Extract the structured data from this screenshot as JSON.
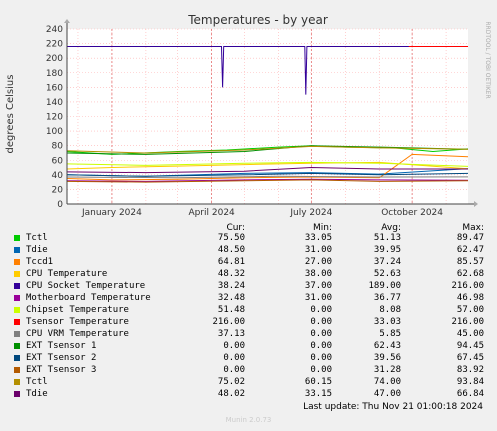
{
  "chart_data": {
    "type": "line",
    "title": "Temperatures - by year",
    "ylabel": "degrees Celsius",
    "side_label": "RRDTOOL / TOBI OETIKER",
    "ylim": [
      0,
      240
    ],
    "yticks": [
      0,
      20,
      40,
      60,
      80,
      100,
      120,
      140,
      160,
      180,
      200,
      220,
      240
    ],
    "xlim": [
      "2023-11-21",
      "2024-11-21"
    ],
    "xticks": [
      {
        "label": "January 2024",
        "date": "2024-01-01"
      },
      {
        "label": "April 2024",
        "date": "2024-04-01"
      },
      {
        "label": "July 2024",
        "date": "2024-07-01"
      },
      {
        "label": "October 2024",
        "date": "2024-10-01"
      }
    ],
    "grid": true,
    "series": [
      {
        "name": "Tctl",
        "color": "#00cc00",
        "points": [
          [
            "2023-11-21",
            72
          ],
          [
            "2024-01-01",
            68
          ],
          [
            "2024-03-01",
            72
          ],
          [
            "2024-04-15",
            74
          ],
          [
            "2024-06-01",
            78
          ],
          [
            "2024-07-01",
            80
          ],
          [
            "2024-08-01",
            78
          ],
          [
            "2024-09-15",
            77
          ],
          [
            "2024-10-20",
            72
          ],
          [
            "2024-11-21",
            75.5
          ]
        ]
      },
      {
        "name": "Tdie",
        "color": "#0066b3",
        "points": [
          [
            "2023-11-21",
            40
          ],
          [
            "2024-02-01",
            38
          ],
          [
            "2024-05-01",
            42
          ],
          [
            "2024-07-01",
            43
          ],
          [
            "2024-09-01",
            41
          ],
          [
            "2024-11-21",
            48.5
          ]
        ]
      },
      {
        "name": "Tccd1",
        "color": "#ff8000",
        "points": [
          [
            "2023-11-21",
            35
          ],
          [
            "2024-01-01",
            33
          ],
          [
            "2024-03-01",
            34
          ],
          [
            "2024-05-01",
            36
          ],
          [
            "2024-07-01",
            37
          ],
          [
            "2024-09-01",
            36
          ],
          [
            "2024-10-01",
            68
          ],
          [
            "2024-11-21",
            64.8
          ]
        ]
      },
      {
        "name": "CPU Temperature",
        "color": "#ffcc00",
        "points": [
          [
            "2023-11-21",
            48
          ],
          [
            "2024-01-01",
            50
          ],
          [
            "2024-03-01",
            52
          ],
          [
            "2024-05-01",
            54
          ],
          [
            "2024-07-01",
            56
          ],
          [
            "2024-09-01",
            57
          ],
          [
            "2024-11-21",
            48.3
          ]
        ]
      },
      {
        "name": "CPU Socket Temperature",
        "color": "#330099",
        "points": [
          [
            "2023-11-21",
            216
          ],
          [
            "2024-04-10",
            216
          ],
          [
            "2024-04-11",
            160
          ],
          [
            "2024-04-12",
            216
          ],
          [
            "2024-06-25",
            216
          ],
          [
            "2024-06-26",
            150
          ],
          [
            "2024-06-27",
            216
          ],
          [
            "2024-11-21",
            216
          ]
        ]
      },
      {
        "name": "Motherboard Temperature",
        "color": "#990099",
        "points": [
          [
            "2023-11-21",
            32
          ],
          [
            "2024-02-01",
            31
          ],
          [
            "2024-05-01",
            33
          ],
          [
            "2024-07-01",
            34
          ],
          [
            "2024-09-01",
            33
          ],
          [
            "2024-11-21",
            32.5
          ]
        ]
      },
      {
        "name": "Chipset Temperature",
        "color": "#ccff00",
        "points": [
          [
            "2023-11-21",
            55
          ],
          [
            "2024-02-01",
            53
          ],
          [
            "2024-05-01",
            56
          ],
          [
            "2024-07-01",
            57
          ],
          [
            "2024-09-01",
            56
          ],
          [
            "2024-11-21",
            51.5
          ]
        ]
      },
      {
        "name": "Tsensor Temperature",
        "color": "#ff0000",
        "points": [
          [
            "2024-09-28",
            216
          ],
          [
            "2024-11-21",
            216
          ]
        ]
      },
      {
        "name": "CPU VRM Temperature",
        "color": "#808080",
        "points": [
          [
            "2023-11-21",
            37
          ],
          [
            "2024-03-01",
            36
          ],
          [
            "2024-06-01",
            38
          ],
          [
            "2024-09-01",
            37
          ],
          [
            "2024-11-21",
            37.1
          ]
        ]
      },
      {
        "name": "EXT Tsensor 1",
        "color": "#008f00",
        "points": [
          [
            "2023-11-21",
            70
          ],
          [
            "2024-02-01",
            68
          ],
          [
            "2024-05-01",
            72
          ],
          [
            "2024-07-01",
            80
          ],
          [
            "2024-09-01",
            78
          ],
          [
            "2024-11-21",
            75
          ]
        ]
      },
      {
        "name": "EXT Tsensor 2",
        "color": "#00487d",
        "points": [
          [
            "2023-11-21",
            40
          ],
          [
            "2024-02-01",
            38
          ],
          [
            "2024-05-01",
            40
          ],
          [
            "2024-07-01",
            42
          ],
          [
            "2024-09-01",
            40
          ],
          [
            "2024-11-21",
            42
          ]
        ]
      },
      {
        "name": "EXT Tsensor 3",
        "color": "#b35a00",
        "points": [
          [
            "2023-11-21",
            31
          ],
          [
            "2024-02-01",
            30
          ],
          [
            "2024-05-01",
            32
          ],
          [
            "2024-07-01",
            33
          ],
          [
            "2024-09-01",
            31
          ],
          [
            "2024-11-21",
            32
          ]
        ]
      },
      {
        "name": "Tctl",
        "color": "#b38f00",
        "points": [
          [
            "2023-11-21",
            73
          ],
          [
            "2024-02-01",
            70
          ],
          [
            "2024-05-01",
            74
          ],
          [
            "2024-07-01",
            79
          ],
          [
            "2024-09-01",
            77
          ],
          [
            "2024-11-21",
            75
          ]
        ]
      },
      {
        "name": "Tdie",
        "color": "#6b006b",
        "points": [
          [
            "2023-11-21",
            44
          ],
          [
            "2024-02-01",
            43
          ],
          [
            "2024-05-01",
            45
          ],
          [
            "2024-07-01",
            50
          ],
          [
            "2024-09-01",
            48
          ],
          [
            "2024-11-21",
            48
          ]
        ]
      }
    ]
  },
  "legend": {
    "headers": {
      "cur": "Cur:",
      "min": "Min:",
      "avg": "Avg:",
      "max": "Max:"
    },
    "rows": [
      {
        "name": "Tctl",
        "color": "#00cc00",
        "cur": "75.50",
        "min": "33.05",
        "avg": "51.13",
        "max": "89.47"
      },
      {
        "name": "Tdie",
        "color": "#0066b3",
        "cur": "48.50",
        "min": "31.00",
        "avg": "39.95",
        "max": "62.47"
      },
      {
        "name": "Tccd1",
        "color": "#ff8000",
        "cur": "64.81",
        "min": "27.00",
        "avg": "37.24",
        "max": "85.57"
      },
      {
        "name": "CPU Temperature",
        "color": "#ffcc00",
        "cur": "48.32",
        "min": "38.00",
        "avg": "52.63",
        "max": "62.68"
      },
      {
        "name": "CPU Socket Temperature",
        "color": "#330099",
        "cur": "38.24",
        "min": "37.00",
        "avg": "189.00",
        "max": "216.00"
      },
      {
        "name": "Motherboard Temperature",
        "color": "#990099",
        "cur": "32.48",
        "min": "31.00",
        "avg": "36.77",
        "max": "46.98"
      },
      {
        "name": "Chipset Temperature",
        "color": "#ccff00",
        "cur": "51.48",
        "min": "0.00",
        "avg": "8.08",
        "max": "57.00"
      },
      {
        "name": "Tsensor Temperature",
        "color": "#ff0000",
        "cur": "216.00",
        "min": "0.00",
        "avg": "33.03",
        "max": "216.00"
      },
      {
        "name": "CPU VRM Temperature",
        "color": "#808080",
        "cur": "37.13",
        "min": "0.00",
        "avg": "5.85",
        "max": "45.00"
      },
      {
        "name": "EXT Tsensor 1",
        "color": "#008f00",
        "cur": "0.00",
        "min": "0.00",
        "avg": "62.43",
        "max": "94.45"
      },
      {
        "name": "EXT Tsensor 2",
        "color": "#00487d",
        "cur": "0.00",
        "min": "0.00",
        "avg": "39.56",
        "max": "67.45"
      },
      {
        "name": "EXT Tsensor 3",
        "color": "#b35a00",
        "cur": "0.00",
        "min": "0.00",
        "avg": "31.28",
        "max": "83.92"
      },
      {
        "name": "Tctl",
        "color": "#b38f00",
        "cur": "75.02",
        "min": "60.15",
        "avg": "74.00",
        "max": "93.84"
      },
      {
        "name": "Tdie",
        "color": "#6b006b",
        "cur": "48.02",
        "min": "33.15",
        "avg": "47.00",
        "max": "66.84"
      }
    ]
  },
  "footer": {
    "last_update": "Last update: Thu Nov 21 01:00:18 2024",
    "munin": "Munin 2.0.73"
  }
}
